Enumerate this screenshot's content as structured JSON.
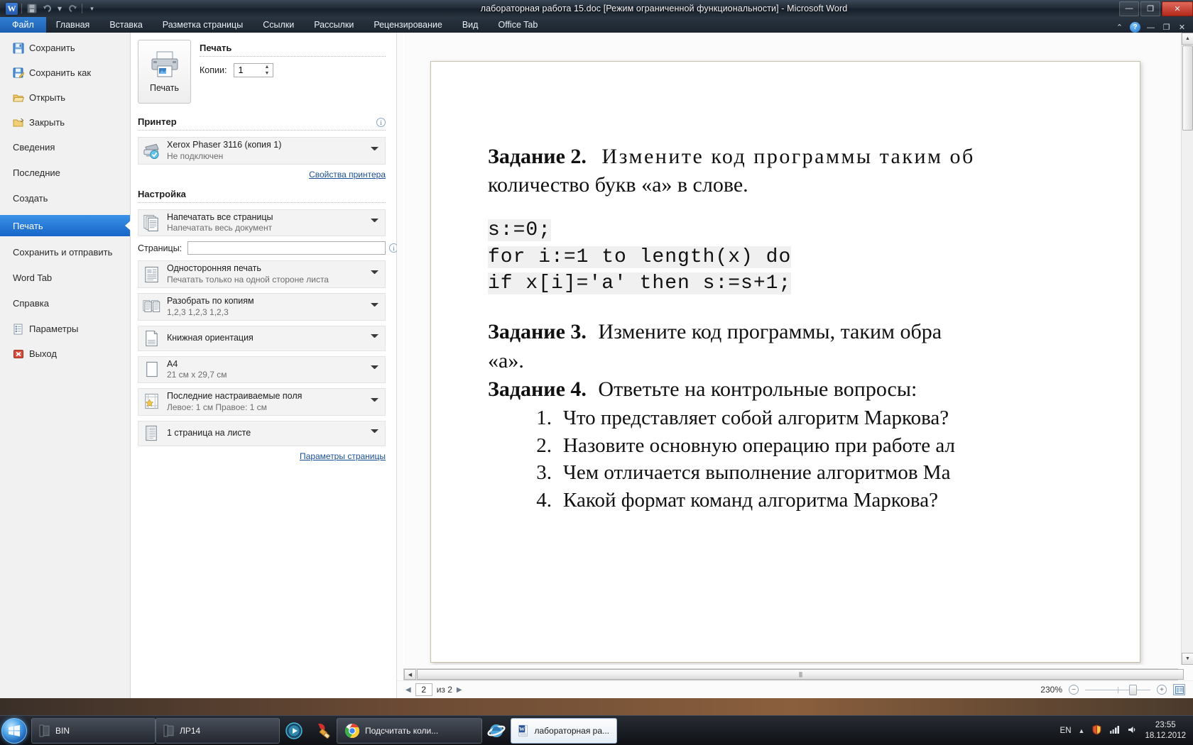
{
  "window": {
    "title": "лабораторная работа 15.doc [Режим ограниченной функциональности]  -  Microsoft Word",
    "app_logo": "W",
    "quick_access": [
      "save-icon",
      "undo-icon",
      "redo-icon",
      "customize-icon"
    ],
    "buttons": {
      "minimize": "—",
      "maximize": "❐",
      "close": "✕"
    }
  },
  "ribbon": {
    "tabs": [
      {
        "label": "Файл",
        "active": true
      },
      {
        "label": "Главная",
        "active": false
      },
      {
        "label": "Вставка",
        "active": false
      },
      {
        "label": "Разметка страницы",
        "active": false
      },
      {
        "label": "Ссылки",
        "active": false
      },
      {
        "label": "Рассылки",
        "active": false
      },
      {
        "label": "Рецензирование",
        "active": false
      },
      {
        "label": "Вид",
        "active": false
      },
      {
        "label": "Office Tab",
        "active": false
      }
    ],
    "right_icons": [
      "collapse-ribbon-icon",
      "help-icon",
      "minimize-ribbon-icon",
      "restore-window-icon",
      "close-window-icon"
    ],
    "help_glyph": "?"
  },
  "backstage": {
    "menu": [
      {
        "label": "Сохранить",
        "icon": "save-icon",
        "selected": false
      },
      {
        "label": "Сохранить как",
        "icon": "save-as-icon",
        "selected": false
      },
      {
        "label": "Открыть",
        "icon": "open-folder-icon",
        "selected": false
      },
      {
        "label": "Закрыть",
        "icon": "close-folder-icon",
        "selected": false
      },
      {
        "label": "Сведения",
        "icon": "",
        "selected": false
      },
      {
        "label": "Последние",
        "icon": "",
        "selected": false
      },
      {
        "label": "Создать",
        "icon": "",
        "selected": false
      },
      {
        "label": "Печать",
        "icon": "",
        "selected": true
      },
      {
        "label": "Сохранить и отправить",
        "icon": "",
        "selected": false
      },
      {
        "label": "Word Tab",
        "icon": "",
        "selected": false
      },
      {
        "label": "Справка",
        "icon": "",
        "selected": false
      },
      {
        "label": "Параметры",
        "icon": "options-icon",
        "selected": false
      },
      {
        "label": "Выход",
        "icon": "exit-icon",
        "selected": false
      }
    ]
  },
  "print": {
    "heading": "Печать",
    "button_label": "Печать",
    "copies_label": "Копии:",
    "copies_value": "1",
    "printer_section": "Принтер",
    "printer_name": "Xerox Phaser 3116 (копия 1)",
    "printer_status": "Не подключен",
    "printer_properties_link": "Свойства принтера",
    "settings_section": "Настройка",
    "options": [
      {
        "title": "Напечатать все страницы",
        "subtitle": "Напечатать весь документ",
        "icon": "pages-stack-icon"
      },
      {
        "title": "Односторонняя печать",
        "subtitle": "Печатать только на одной стороне листа",
        "icon": "one-sided-icon"
      },
      {
        "title": "Разобрать по копиям",
        "subtitle": "1,2,3   1,2,3   1,2,3",
        "icon": "collate-icon"
      },
      {
        "title": "Книжная ориентация",
        "subtitle": "",
        "icon": "portrait-icon"
      },
      {
        "title": "A4",
        "subtitle": "21 см x 29,7 см",
        "icon": "paper-size-icon"
      },
      {
        "title": "Последние настраиваемые поля",
        "subtitle": "Левое: 1 см   Правое: 1 см",
        "icon": "margins-icon"
      },
      {
        "title": "1 страница на листе",
        "subtitle": "",
        "icon": "pages-per-sheet-icon"
      }
    ],
    "pages_label": "Страницы:",
    "pages_value": "",
    "page_setup_link": "Параметры страницы"
  },
  "document": {
    "task2_label": "Задание 2.",
    "task2_text": "Измените код программы таким об",
    "task2_line2": "количество букв «а» в слове.",
    "code_lines": [
      "s:=0;",
      "for i:=1 to length(x) do",
      "if x[i]='a' then s:=s+1;"
    ],
    "task3_label": "Задание 3.",
    "task3_text": "Измените код программы, таким обра",
    "task3_line2": "«а».",
    "task4_label": "Задание 4.",
    "task4_text": "Ответьте на контрольные вопросы:",
    "questions": [
      {
        "n": "1.",
        "text": "Что представляет собой алгоритм Маркова?"
      },
      {
        "n": "2.",
        "text": "Назовите основную операцию при работе ал"
      },
      {
        "n": "3.",
        "text": "Чем отличается выполнение алгоритмов Ма"
      },
      {
        "n": "4.",
        "text": "Какой формат команд алгоритма Маркова?"
      }
    ]
  },
  "status": {
    "page_value": "2",
    "page_of": "из 2",
    "zoom_percent": "230%",
    "zoom_out_glyph": "−",
    "zoom_in_glyph": "+",
    "prev_page_icon": "prev-page-icon",
    "next_page_icon": "next-page-icon"
  },
  "taskbar": {
    "start_label": "start-orb",
    "items": [
      {
        "label": "BIN",
        "icon": "explorer-folder-icon",
        "active": false
      },
      {
        "label": "ЛР14",
        "icon": "explorer-folder-icon",
        "active": false
      },
      {
        "label": "",
        "icon": "media-player-icon",
        "active": false
      },
      {
        "label": "",
        "icon": "ccleaner-icon",
        "active": false
      },
      {
        "label": "Подсчитать коли...",
        "icon": "chrome-icon",
        "active": false
      },
      {
        "label": "",
        "icon": "internet-explorer-icon",
        "active": false
      },
      {
        "label": "лабораторная ра...",
        "icon": "word-icon",
        "active": true
      }
    ],
    "tray": {
      "language": "EN",
      "time": "23:55",
      "date": "18.12.2012"
    }
  }
}
